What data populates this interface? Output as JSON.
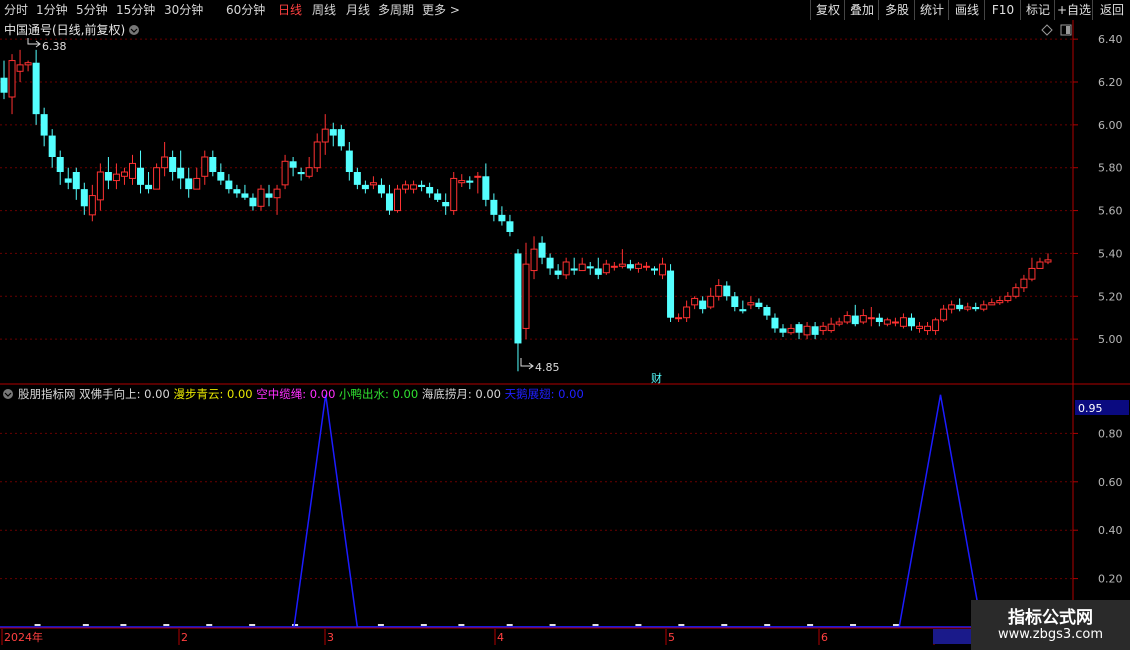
{
  "toolbar": {
    "periods": [
      "分时",
      "1分钟",
      "5分钟",
      "15分钟",
      "30分钟",
      "60分钟",
      "日线",
      "周线",
      "月线",
      "多周期",
      "更多 >"
    ],
    "active_period": "日线",
    "right_buttons": [
      "复权",
      "叠加",
      "多股",
      "统计",
      "画线",
      "F10",
      "标记",
      "+自选",
      "返回"
    ]
  },
  "main_panel": {
    "title": "中国通号(日线,前复权)",
    "high_label": "6.38",
    "low_label": "4.85",
    "finance_marker": "财"
  },
  "indicator_panel": {
    "name": "股朋指标网",
    "items": [
      {
        "label": "双佛手向上:",
        "value": "0.00",
        "color": "#d8d8d8"
      },
      {
        "label": "漫步青云:",
        "value": "0.00",
        "color": "#e8e800"
      },
      {
        "label": "空中缆绳:",
        "value": "0.00",
        "color": "#ff30ff"
      },
      {
        "label": "小鸭出水:",
        "value": "0.00",
        "color": "#30e030"
      },
      {
        "label": "海底捞月:",
        "value": "0.00",
        "color": "#d8d8d8"
      },
      {
        "label": "天鹅展翅:",
        "value": "0.00",
        "color": "#2020ff"
      }
    ],
    "current_value": "0.95"
  },
  "time_axis": [
    "2024年",
    "2",
    "3",
    "4",
    "5",
    "6",
    "2025/0"
  ],
  "watermark": {
    "title": "指标公式网",
    "url": "www.zbgs3.com"
  },
  "colors": {
    "up": "#ff3232",
    "down": "#54ffff",
    "grid": "#6a0000",
    "axis": "#b00000",
    "signal": "#1c1cff"
  },
  "chart_data": [
    {
      "type": "candlestick",
      "title": "中国通号(日线,前复权)",
      "ylim": [
        4.8,
        6.48
      ],
      "yticks": [
        5.0,
        5.2,
        5.4,
        5.6,
        5.8,
        6.0,
        6.2,
        6.4
      ],
      "annotations": [
        {
          "text": "6.38",
          "kind": "high"
        },
        {
          "text": "4.85",
          "kind": "low"
        }
      ],
      "candles": [
        [
          6.22,
          6.15,
          6.3,
          6.12
        ],
        [
          6.13,
          6.3,
          6.33,
          6.05
        ],
        [
          6.25,
          6.28,
          6.35,
          6.2
        ],
        [
          6.28,
          6.29,
          6.3,
          6.25
        ],
        [
          6.29,
          6.05,
          6.35,
          6.0
        ],
        [
          6.05,
          5.95,
          6.08,
          5.9
        ],
        [
          5.95,
          5.85,
          5.98,
          5.8
        ],
        [
          5.85,
          5.78,
          5.88,
          5.72
        ],
        [
          5.75,
          5.73,
          5.8,
          5.7
        ],
        [
          5.78,
          5.7,
          5.8,
          5.65
        ],
        [
          5.7,
          5.62,
          5.73,
          5.58
        ],
        [
          5.58,
          5.67,
          5.72,
          5.55
        ],
        [
          5.65,
          5.78,
          5.82,
          5.6
        ],
        [
          5.78,
          5.74,
          5.85,
          5.7
        ],
        [
          5.74,
          5.77,
          5.82,
          5.7
        ],
        [
          5.76,
          5.78,
          5.8,
          5.72
        ],
        [
          5.75,
          5.82,
          5.86,
          5.72
        ],
        [
          5.8,
          5.72,
          5.88,
          5.68
        ],
        [
          5.72,
          5.7,
          5.78,
          5.68
        ],
        [
          5.7,
          5.8,
          5.82,
          5.7
        ],
        [
          5.8,
          5.85,
          5.92,
          5.76
        ],
        [
          5.85,
          5.78,
          5.88,
          5.74
        ],
        [
          5.8,
          5.75,
          5.88,
          5.7
        ],
        [
          5.75,
          5.7,
          5.8,
          5.66
        ],
        [
          5.7,
          5.75,
          5.8,
          5.7
        ],
        [
          5.76,
          5.85,
          5.88,
          5.72
        ],
        [
          5.85,
          5.78,
          5.88,
          5.76
        ],
        [
          5.78,
          5.74,
          5.82,
          5.72
        ],
        [
          5.74,
          5.7,
          5.77,
          5.68
        ],
        [
          5.7,
          5.68,
          5.72,
          5.66
        ],
        [
          5.68,
          5.66,
          5.72,
          5.65
        ],
        [
          5.66,
          5.62,
          5.68,
          5.6
        ],
        [
          5.62,
          5.7,
          5.72,
          5.6
        ],
        [
          5.68,
          5.66,
          5.72,
          5.62
        ],
        [
          5.66,
          5.7,
          5.72,
          5.58
        ],
        [
          5.72,
          5.83,
          5.86,
          5.7
        ],
        [
          5.83,
          5.8,
          5.85,
          5.76
        ],
        [
          5.78,
          5.77,
          5.8,
          5.74
        ],
        [
          5.76,
          5.8,
          5.85,
          5.75
        ],
        [
          5.8,
          5.92,
          5.96,
          5.78
        ],
        [
          5.92,
          5.98,
          6.05,
          5.86
        ],
        [
          5.98,
          5.95,
          6.01,
          5.9
        ],
        [
          5.98,
          5.9,
          6.0,
          5.88
        ],
        [
          5.88,
          5.78,
          5.92,
          5.74
        ],
        [
          5.78,
          5.72,
          5.8,
          5.7
        ],
        [
          5.72,
          5.7,
          5.74,
          5.68
        ],
        [
          5.72,
          5.73,
          5.76,
          5.7
        ],
        [
          5.72,
          5.68,
          5.75,
          5.66
        ],
        [
          5.68,
          5.6,
          5.72,
          5.58
        ],
        [
          5.6,
          5.7,
          5.72,
          5.59
        ],
        [
          5.7,
          5.72,
          5.74,
          5.68
        ],
        [
          5.7,
          5.72,
          5.74,
          5.68
        ],
        [
          5.72,
          5.71,
          5.74,
          5.69
        ],
        [
          5.71,
          5.68,
          5.73,
          5.66
        ],
        [
          5.68,
          5.65,
          5.7,
          5.64
        ],
        [
          5.64,
          5.62,
          5.68,
          5.58
        ],
        [
          5.6,
          5.75,
          5.78,
          5.58
        ],
        [
          5.73,
          5.74,
          5.77,
          5.71
        ],
        [
          5.74,
          5.73,
          5.76,
          5.7
        ],
        [
          5.76,
          5.76,
          5.78,
          5.68
        ],
        [
          5.76,
          5.65,
          5.82,
          5.62
        ],
        [
          5.65,
          5.58,
          5.68,
          5.55
        ],
        [
          5.58,
          5.55,
          5.62,
          5.53
        ],
        [
          5.55,
          5.5,
          5.58,
          5.48
        ],
        [
          5.4,
          4.98,
          5.42,
          4.85
        ],
        [
          5.05,
          5.35,
          5.45,
          5.0
        ],
        [
          5.32,
          5.42,
          5.48,
          5.28
        ],
        [
          5.45,
          5.38,
          5.48,
          5.35
        ],
        [
          5.38,
          5.33,
          5.4,
          5.3
        ],
        [
          5.32,
          5.3,
          5.35,
          5.28
        ],
        [
          5.3,
          5.36,
          5.38,
          5.28
        ],
        [
          5.33,
          5.32,
          5.38,
          5.3
        ],
        [
          5.32,
          5.35,
          5.38,
          5.32
        ],
        [
          5.34,
          5.33,
          5.36,
          5.3
        ],
        [
          5.33,
          5.3,
          5.38,
          5.28
        ],
        [
          5.31,
          5.35,
          5.37,
          5.3
        ],
        [
          5.34,
          5.34,
          5.36,
          5.32
        ],
        [
          5.34,
          5.35,
          5.42,
          5.33
        ],
        [
          5.35,
          5.33,
          5.37,
          5.32
        ],
        [
          5.33,
          5.35,
          5.36,
          5.31
        ],
        [
          5.34,
          5.34,
          5.36,
          5.32
        ],
        [
          5.33,
          5.32,
          5.34,
          5.3
        ],
        [
          5.3,
          5.35,
          5.38,
          5.28
        ],
        [
          5.32,
          5.1,
          5.35,
          5.08
        ],
        [
          5.1,
          5.1,
          5.12,
          5.08
        ],
        [
          5.1,
          5.15,
          5.18,
          5.08
        ],
        [
          5.16,
          5.19,
          5.2,
          5.14
        ],
        [
          5.18,
          5.14,
          5.2,
          5.12
        ],
        [
          5.15,
          5.2,
          5.24,
          5.14
        ],
        [
          5.2,
          5.25,
          5.28,
          5.18
        ],
        [
          5.25,
          5.2,
          5.27,
          5.18
        ],
        [
          5.2,
          5.15,
          5.22,
          5.13
        ],
        [
          5.14,
          5.13,
          5.18,
          5.12
        ],
        [
          5.16,
          5.17,
          5.2,
          5.14
        ],
        [
          5.17,
          5.15,
          5.19,
          5.14
        ],
        [
          5.15,
          5.11,
          5.16,
          5.09
        ],
        [
          5.1,
          5.05,
          5.12,
          5.03
        ],
        [
          5.05,
          5.03,
          5.07,
          5.01
        ],
        [
          5.03,
          5.05,
          5.07,
          5.02
        ],
        [
          5.07,
          5.03,
          5.08,
          5.0
        ],
        [
          5.02,
          5.06,
          5.08,
          5.0
        ],
        [
          5.06,
          5.02,
          5.08,
          5.0
        ],
        [
          5.04,
          5.06,
          5.08,
          5.02
        ],
        [
          5.04,
          5.07,
          5.1,
          5.03
        ],
        [
          5.07,
          5.08,
          5.1,
          5.06
        ],
        [
          5.08,
          5.11,
          5.13,
          5.07
        ],
        [
          5.11,
          5.07,
          5.16,
          5.06
        ],
        [
          5.08,
          5.11,
          5.14,
          5.07
        ],
        [
          5.1,
          5.1,
          5.15,
          5.06
        ],
        [
          5.1,
          5.08,
          5.12,
          5.06
        ],
        [
          5.07,
          5.09,
          5.1,
          5.06
        ],
        [
          5.08,
          5.08,
          5.1,
          5.06
        ],
        [
          5.06,
          5.1,
          5.12,
          5.05
        ],
        [
          5.1,
          5.06,
          5.12,
          5.04
        ],
        [
          5.05,
          5.06,
          5.08,
          5.03
        ],
        [
          5.04,
          5.06,
          5.08,
          5.02
        ],
        [
          5.04,
          5.09,
          5.1,
          5.02
        ],
        [
          5.09,
          5.14,
          5.16,
          5.08
        ],
        [
          5.14,
          5.16,
          5.18,
          5.12
        ],
        [
          5.16,
          5.14,
          5.19,
          5.13
        ],
        [
          5.14,
          5.15,
          5.17,
          5.13
        ],
        [
          5.15,
          5.14,
          5.17,
          5.13
        ],
        [
          5.14,
          5.16,
          5.18,
          5.13
        ],
        [
          5.16,
          5.17,
          5.19,
          5.16
        ],
        [
          5.17,
          5.18,
          5.2,
          5.16
        ],
        [
          5.18,
          5.2,
          5.22,
          5.17
        ],
        [
          5.2,
          5.24,
          5.26,
          5.19
        ],
        [
          5.24,
          5.28,
          5.3,
          5.22
        ],
        [
          5.28,
          5.33,
          5.38,
          5.27
        ],
        [
          5.33,
          5.36,
          5.38,
          5.33
        ],
        [
          5.36,
          5.37,
          5.4,
          5.35
        ]
      ]
    },
    {
      "type": "line",
      "title": "股朋指标网",
      "ylim": [
        0,
        1.0
      ],
      "yticks": [
        0.2,
        0.4,
        0.6,
        0.8
      ],
      "series": [
        {
          "name": "天鹅展翅",
          "points": [
            [
              0.274,
              0
            ],
            [
              0.3035,
              0.96
            ],
            [
              0.333,
              0
            ],
            [
              0.838,
              0
            ],
            [
              0.8765,
              0.96
            ],
            [
              0.915,
              0
            ]
          ]
        }
      ],
      "baseline_markers": [
        0.035,
        0.08,
        0.115,
        0.155,
        0.195,
        0.235,
        0.275,
        0.355,
        0.395,
        0.43,
        0.475,
        0.515,
        0.555,
        0.595,
        0.635,
        0.675,
        0.715,
        0.755,
        0.795,
        0.835
      ]
    }
  ]
}
